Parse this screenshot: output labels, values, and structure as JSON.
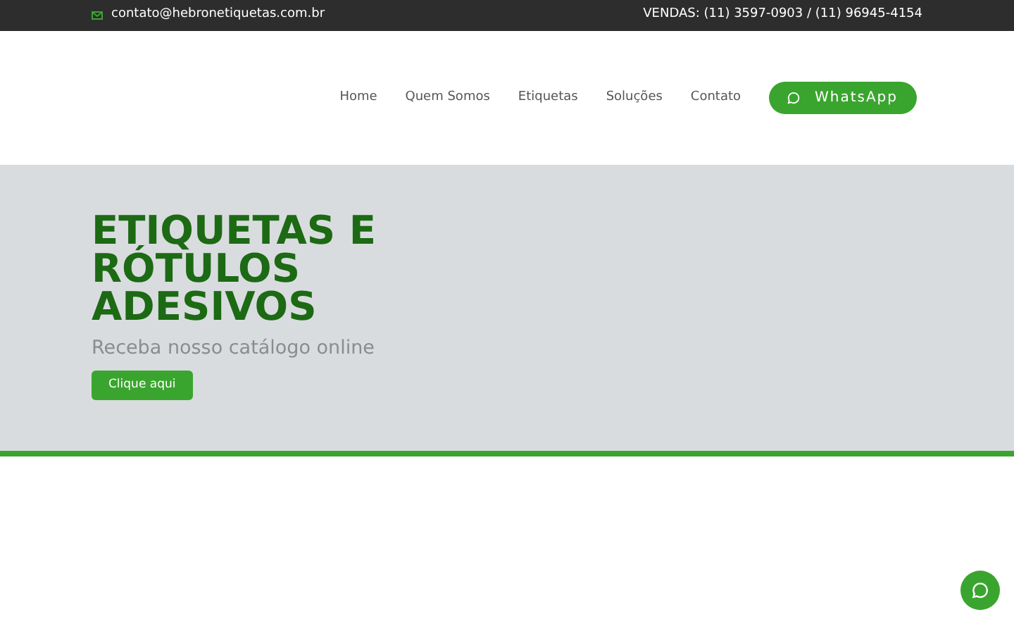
{
  "top_bar": {
    "email": "contato@hebronetiquetas.com.br",
    "sales": "VENDAS: (11) 3597-0903 / (11) 96945-4154"
  },
  "nav": {
    "items": [
      "Home",
      "Quem Somos",
      "Etiquetas",
      "Soluções",
      "Contato"
    ],
    "whatsapp_button": "WhatsApp"
  },
  "hero": {
    "title": "ETIQUETAS E RÓTULOS ADESIVOS",
    "subtitle": "Receba nosso catálogo online",
    "button": "Clique aqui"
  }
}
